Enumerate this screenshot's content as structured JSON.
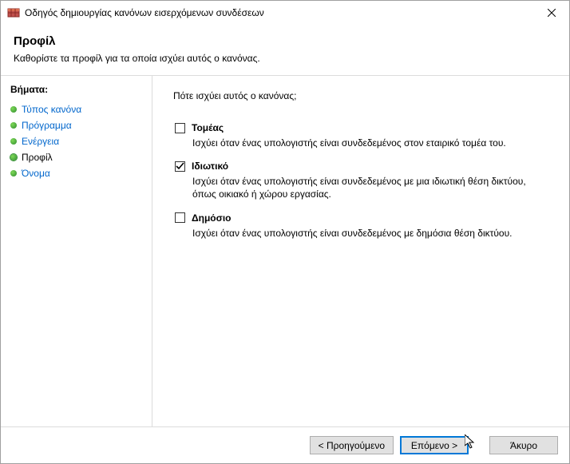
{
  "window": {
    "title": "Οδηγός δημιουργίας κανόνων εισερχόμενων συνδέσεων"
  },
  "header": {
    "title": "Προφίλ",
    "subtitle": "Καθορίστε τα προφίλ για τα οποία ισχύει αυτός ο κανόνας."
  },
  "sidebar": {
    "heading": "Βήματα:",
    "items": [
      {
        "label": "Τύπος κανόνα",
        "state": "done"
      },
      {
        "label": "Πρόγραμμα",
        "state": "done"
      },
      {
        "label": "Ενέργεια",
        "state": "done"
      },
      {
        "label": "Προφίλ",
        "state": "active"
      },
      {
        "label": "Όνομα",
        "state": "upcoming"
      }
    ]
  },
  "content": {
    "prompt": "Πότε ισχύει αυτός ο κανόνας;",
    "options": [
      {
        "key": "domain",
        "label": "Τομέας",
        "checked": false,
        "desc": "Ισχύει όταν ένας υπολογιστής είναι συνδεδεμένος στον εταιρικό τομέα του."
      },
      {
        "key": "private",
        "label": "Ιδιωτικό",
        "checked": true,
        "desc": "Ισχύει όταν ένας υπολογιστής είναι συνδεδεμένος με μια ιδιωτική θέση δικτύου, όπως οικιακό ή χώρου εργασίας."
      },
      {
        "key": "public",
        "label": "Δημόσιο",
        "checked": false,
        "desc": "Ισχύει όταν ένας υπολογιστής είναι συνδεδεμένος με δημόσια θέση δικτύου."
      }
    ]
  },
  "footer": {
    "back": "< Προηγούμενο",
    "next": "Επόμενο >",
    "cancel": "Άκυρο"
  }
}
